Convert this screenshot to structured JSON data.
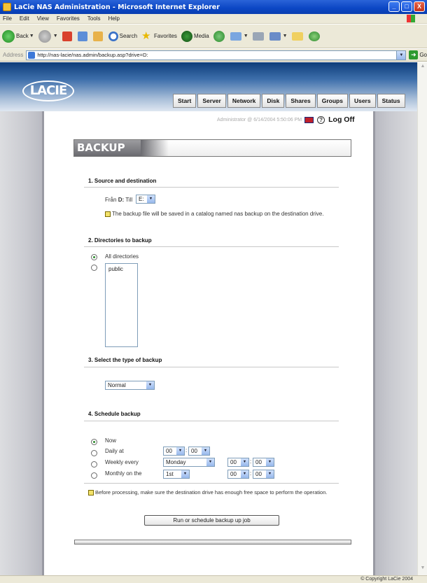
{
  "window": {
    "title": "LaCie NAS Administration - Microsoft Internet Explorer",
    "minimize": "_",
    "maximize": "□",
    "close": "X"
  },
  "menubar": [
    "File",
    "Edit",
    "View",
    "Favorites",
    "Tools",
    "Help"
  ],
  "toolbar": {
    "back": "Back",
    "search": "Search",
    "favorites": "Favorites",
    "media": "Media"
  },
  "address": {
    "label": "Address",
    "url": "http://nas-lacie/nas.admin/backup.asp?drive=D:",
    "go": "Go"
  },
  "page": {
    "logo": "LACIE",
    "nav": [
      "Start",
      "Server",
      "Network",
      "Disk",
      "Shares",
      "Groups",
      "Users",
      "Status"
    ],
    "user_info": "Administrator @ 6/14/2004 5:50:06 PM",
    "help": "?",
    "logoff": "Log Off",
    "title": "BACKUP",
    "section1": {
      "title": "1. Source and destination",
      "from_label": "Från",
      "from_value": "D:",
      "to_label": "Till",
      "to_value": "E:",
      "note": "The backup file will be saved in a catalog named nas backup on the destination drive."
    },
    "section2": {
      "title": "2. Directories to backup",
      "all_label": "All directories",
      "list_items": [
        "public"
      ]
    },
    "section3": {
      "title": "3. Select the type of backup",
      "type_value": "Normal"
    },
    "section4": {
      "title": "4. Schedule backup",
      "now_label": "Now",
      "daily_label": "Daily at",
      "weekly_label": "Weekly every",
      "monthly_label": "Monthly on the",
      "hour": "00",
      "minute": "00",
      "weekday": "Monday",
      "monthday": "1st",
      "sep": ":",
      "note": "Before processing, make sure the destination drive has enough free space to perform the operation."
    },
    "run_button": "Run or schedule backup up job"
  },
  "status": {
    "copyright": "© Copyright LaCie 2004"
  }
}
